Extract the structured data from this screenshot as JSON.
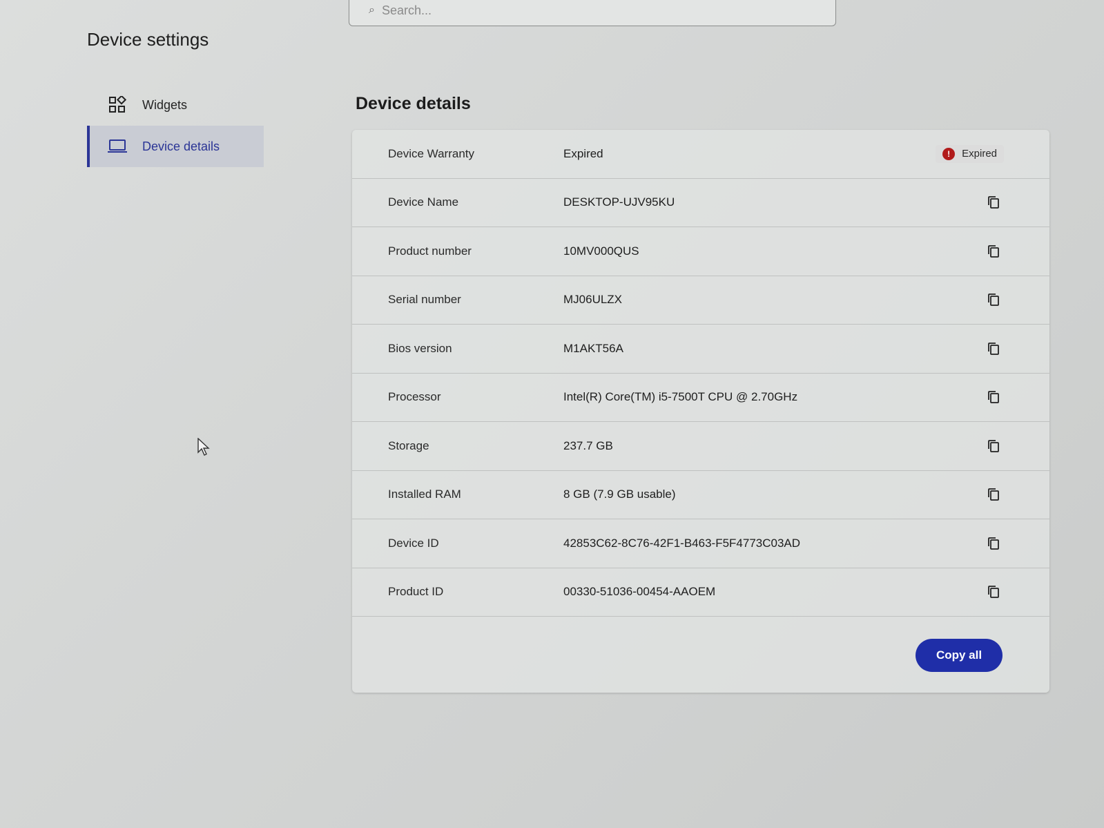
{
  "search": {
    "placeholder": "Search..."
  },
  "page_title": "Device settings",
  "sidebar": {
    "items": [
      {
        "label": "Widgets",
        "icon": "widgets-icon",
        "active": false
      },
      {
        "label": "Device details",
        "icon": "laptop-icon",
        "active": true
      }
    ]
  },
  "main": {
    "title": "Device details",
    "rows": [
      {
        "label": "Device Warranty",
        "value": "Expired",
        "status": "Expired"
      },
      {
        "label": "Device Name",
        "value": "DESKTOP-UJV95KU"
      },
      {
        "label": "Product number",
        "value": "10MV000QUS"
      },
      {
        "label": "Serial number",
        "value": "MJ06ULZX"
      },
      {
        "label": "Bios version",
        "value": "M1AKT56A"
      },
      {
        "label": "Processor",
        "value": "Intel(R) Core(TM) i5-7500T CPU @ 2.70GHz"
      },
      {
        "label": "Storage",
        "value": "237.7 GB"
      },
      {
        "label": "Installed RAM",
        "value": "8 GB (7.9 GB usable)"
      },
      {
        "label": "Device ID",
        "value": "42853C62-8C76-42F1-B463-F5F4773C03AD"
      },
      {
        "label": "Product ID",
        "value": "00330-51036-00454-AAOEM"
      }
    ],
    "copy_all_label": "Copy all"
  },
  "colors": {
    "accent": "#1f2ea8",
    "nav_active_text": "#2b3596",
    "status_error": "#b11b1b"
  }
}
